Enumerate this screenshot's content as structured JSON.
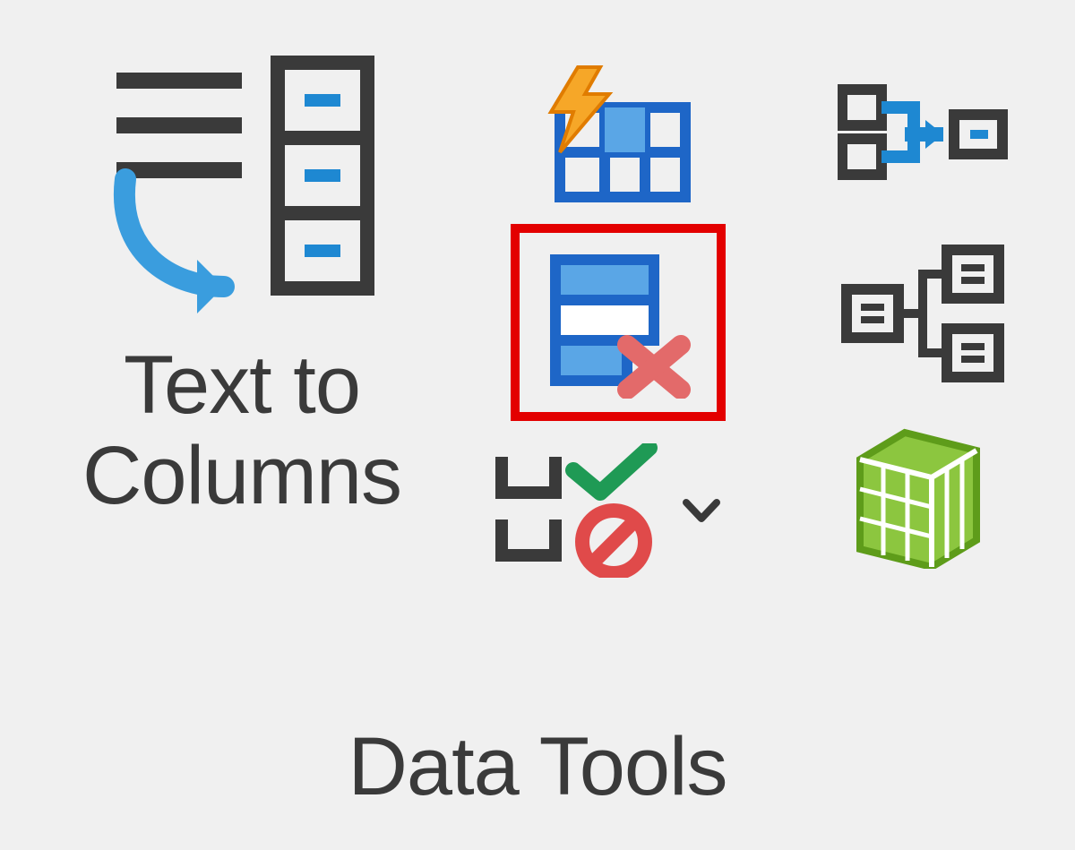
{
  "ribbon_group": {
    "title": "Data Tools",
    "buttons": {
      "text_to_columns": {
        "label": "Text to\nColumns",
        "icon": "text-to-columns-icon"
      },
      "flash_fill": {
        "icon": "flash-fill-icon"
      },
      "remove_duplicates": {
        "icon": "remove-duplicates-icon",
        "highlighted": true
      },
      "data_validation": {
        "icon": "data-validation-icon",
        "has_dropdown": true
      },
      "consolidate": {
        "icon": "consolidate-icon"
      },
      "relationships": {
        "icon": "relationships-icon"
      },
      "data_model": {
        "icon": "manage-data-model-icon"
      }
    }
  }
}
